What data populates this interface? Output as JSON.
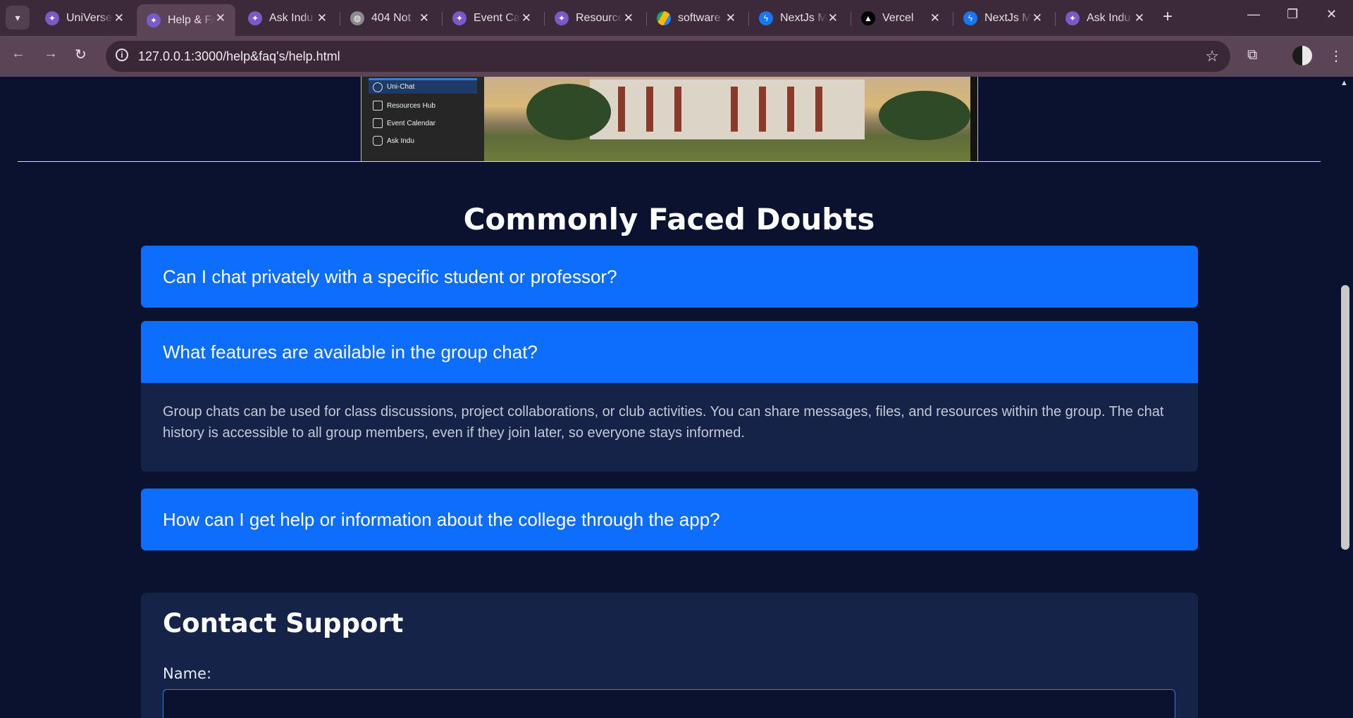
{
  "browser": {
    "tabs": [
      {
        "title": "UniVerse",
        "icon": "universe-icon",
        "active": false
      },
      {
        "title": "Help & FAQ",
        "icon": "universe-icon",
        "active": true
      },
      {
        "title": "Ask Indu",
        "icon": "universe-icon",
        "active": false
      },
      {
        "title": "404 Not",
        "icon": "globe-icon",
        "active": false
      },
      {
        "title": "Event Ca",
        "icon": "universe-icon",
        "active": false
      },
      {
        "title": "Resource",
        "icon": "universe-icon",
        "active": false
      },
      {
        "title": "software",
        "icon": "drive-icon",
        "active": false
      },
      {
        "title": "NextJs M",
        "icon": "messenger-icon",
        "active": false
      },
      {
        "title": "Vercel",
        "icon": "vercel-icon",
        "active": false
      },
      {
        "title": "NextJs M",
        "icon": "messenger-icon",
        "active": false
      },
      {
        "title": "Ask Indu",
        "icon": "universe-icon",
        "active": false
      }
    ],
    "url": "127.0.0.1:3000/help&faq's/help.html"
  },
  "preview": {
    "sidebar_items": [
      "Uni-Chat",
      "Resources Hub",
      "Event Calendar",
      "Ask Indu"
    ]
  },
  "faq": {
    "heading": "Commonly Faced Doubts",
    "items": [
      {
        "question": "Can I chat privately with a specific student or professor?",
        "answer": ""
      },
      {
        "question": "What features are available in the group chat?",
        "answer": "Group chats can be used for class discussions, project collaborations, or club activities. You can share messages, files, and resources within the group. The chat history is accessible to all group members, even if they join later, so everyone stays informed."
      },
      {
        "question": "How can I get help or information about the college through the app?",
        "answer": ""
      }
    ]
  },
  "contact": {
    "heading": "Contact Support",
    "name_label": "Name:",
    "name_value": ""
  },
  "colors": {
    "page_bg": "#0b1230",
    "faq_question_bg": "#0d6efd",
    "card_bg": "#152348"
  }
}
